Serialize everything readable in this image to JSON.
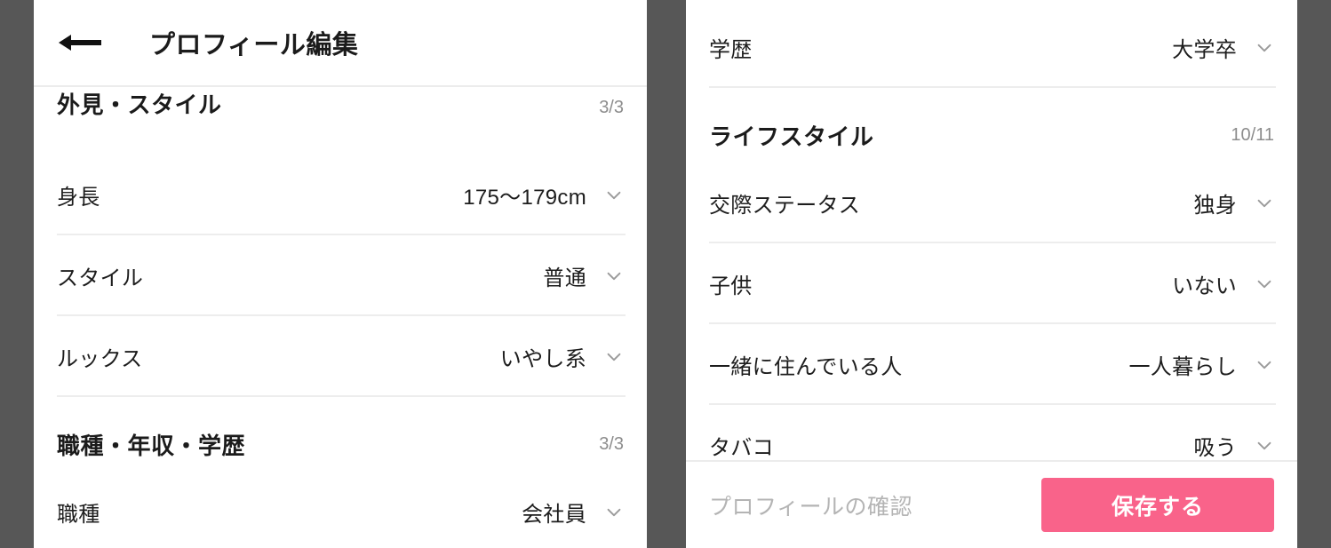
{
  "window": {
    "background_color": "#575757",
    "panel_background": "#ffffff"
  },
  "header": {
    "back_icon": "arrow-left-icon",
    "title": "プロフィール編集"
  },
  "left_panel": {
    "sections": [
      {
        "title": "外見・スタイル",
        "count": "3/3",
        "rows": [
          {
            "label": "身長",
            "value": "175〜179cm",
            "icon": "chevron-down-icon"
          },
          {
            "label": "スタイル",
            "value": "普通",
            "icon": "chevron-down-icon"
          },
          {
            "label": "ルックス",
            "value": "いやし系",
            "icon": "chevron-down-icon"
          }
        ]
      },
      {
        "title": "職種・年収・学歴",
        "count": "3/3",
        "rows": [
          {
            "label": "職種",
            "value": "会社員",
            "icon": "chevron-down-icon"
          }
        ]
      }
    ]
  },
  "right_panel": {
    "top_rows": [
      {
        "label": "学歴",
        "value": "大学卒",
        "icon": "chevron-down-icon"
      }
    ],
    "sections": [
      {
        "title": "ライフスタイル",
        "count": "10/11",
        "rows": [
          {
            "label": "交際ステータス",
            "value": "独身",
            "icon": "chevron-down-icon"
          },
          {
            "label": "子供",
            "value": "いない",
            "icon": "chevron-down-icon"
          },
          {
            "label": "一緒に住んでいる人",
            "value": "一人暮らし",
            "icon": "chevron-down-icon"
          },
          {
            "label": "タバコ",
            "value": "吸う",
            "icon": "chevron-down-icon"
          }
        ]
      }
    ],
    "bottom_bar": {
      "confirm_label": "プロフィールの確認",
      "save_label": "保存する",
      "save_color": "#f9638a",
      "confirm_color": "#b4b4b4"
    }
  }
}
